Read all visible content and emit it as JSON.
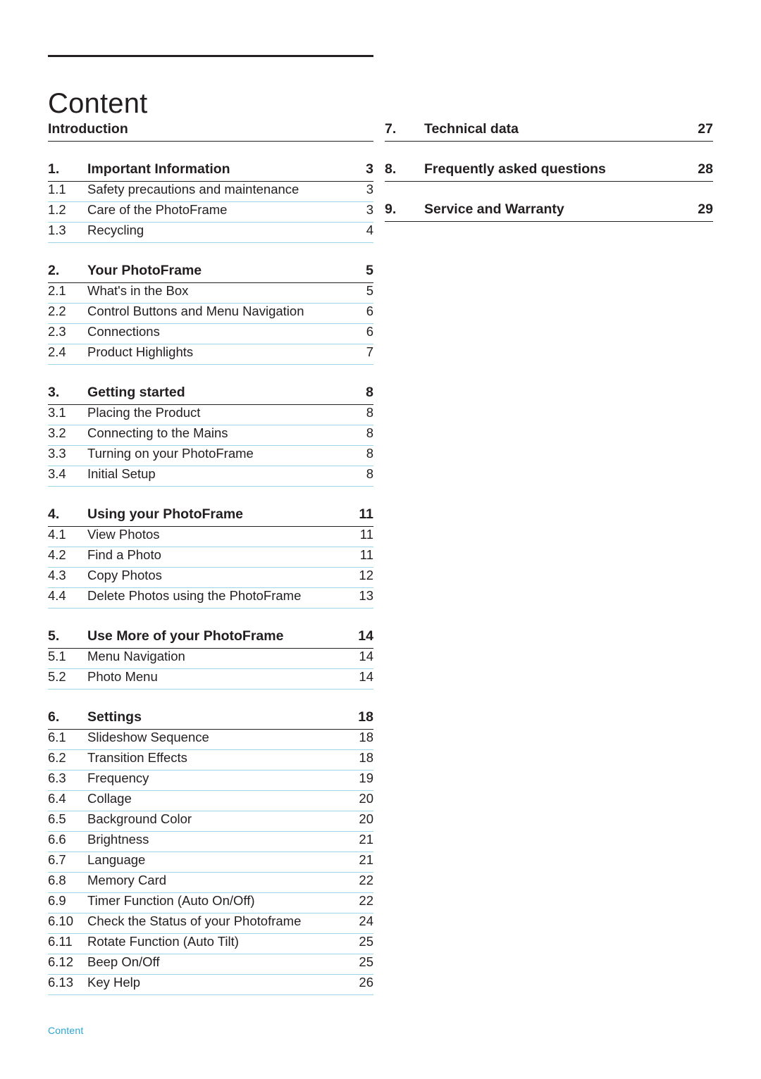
{
  "document": {
    "title": "Content",
    "footer": "Content",
    "accent_color": "#2ba6d9",
    "rule_color": "#9fd4e8",
    "text_color": "#231f20"
  },
  "left_column": [
    {
      "heading": {
        "num": "",
        "label": "Introduction",
        "page": ""
      },
      "entries": []
    },
    {
      "heading": {
        "num": "1.",
        "label": "Important Information",
        "page": "3"
      },
      "entries": [
        {
          "num": "1.1",
          "label": "Safety precautions and maintenance",
          "page": "3"
        },
        {
          "num": "1.2",
          "label": "Care of the PhotoFrame",
          "page": "3"
        },
        {
          "num": "1.3",
          "label": "Recycling",
          "page": "4"
        }
      ]
    },
    {
      "heading": {
        "num": "2.",
        "label": "Your PhotoFrame",
        "page": "5"
      },
      "entries": [
        {
          "num": "2.1",
          "label": "What's in the Box",
          "page": "5"
        },
        {
          "num": "2.2",
          "label": "Control Buttons and Menu Navigation",
          "page": "6"
        },
        {
          "num": "2.3",
          "label": "Connections",
          "page": "6"
        },
        {
          "num": "2.4",
          "label": "Product Highlights",
          "page": "7"
        }
      ]
    },
    {
      "heading": {
        "num": "3.",
        "label": "Getting started",
        "page": "8"
      },
      "entries": [
        {
          "num": "3.1",
          "label": "Placing the Product",
          "page": "8"
        },
        {
          "num": "3.2",
          "label": "Connecting to the Mains",
          "page": "8"
        },
        {
          "num": "3.3",
          "label": "Turning on your PhotoFrame",
          "page": "8"
        },
        {
          "num": "3.4",
          "label": "Initial Setup",
          "page": "8"
        }
      ]
    },
    {
      "heading": {
        "num": "4.",
        "label": "Using your PhotoFrame",
        "page": "11"
      },
      "entries": [
        {
          "num": "4.1",
          "label": "View Photos",
          "page": "11"
        },
        {
          "num": "4.2",
          "label": "Find a Photo",
          "page": "11"
        },
        {
          "num": "4.3",
          "label": "Copy Photos",
          "page": "12"
        },
        {
          "num": "4.4",
          "label": "Delete Photos using the PhotoFrame",
          "page": "13"
        }
      ]
    },
    {
      "heading": {
        "num": "5.",
        "label": "Use More of your PhotoFrame",
        "page": "14"
      },
      "entries": [
        {
          "num": "5.1",
          "label": "Menu Navigation",
          "page": "14"
        },
        {
          "num": "5.2",
          "label": "Photo Menu",
          "page": "14"
        }
      ]
    },
    {
      "heading": {
        "num": "6.",
        "label": "Settings",
        "page": "18"
      },
      "entries": [
        {
          "num": "6.1",
          "label": "Slideshow Sequence",
          "page": "18"
        },
        {
          "num": "6.2",
          "label": "Transition Effects",
          "page": "18"
        },
        {
          "num": "6.3",
          "label": "Frequency",
          "page": "19"
        },
        {
          "num": "6.4",
          "label": "Collage",
          "page": "20"
        },
        {
          "num": "6.5",
          "label": "Background Color",
          "page": "20"
        },
        {
          "num": "6.6",
          "label": "Brightness",
          "page": "21"
        },
        {
          "num": "6.7",
          "label": "Language",
          "page": "21"
        },
        {
          "num": "6.8",
          "label": "Memory Card",
          "page": "22"
        },
        {
          "num": "6.9",
          "label": "Timer Function (Auto On/Off)",
          "page": "22"
        },
        {
          "num": "6.10",
          "label": "Check the Status of your Photoframe",
          "page": "24"
        },
        {
          "num": "6.11",
          "label": "Rotate Function (Auto Tilt)",
          "page": "25"
        },
        {
          "num": "6.12",
          "label": "Beep On/Off",
          "page": "25"
        },
        {
          "num": "6.13",
          "label": "Key Help",
          "page": "26"
        }
      ]
    }
  ],
  "right_column": [
    {
      "heading": {
        "num": "7.",
        "label": "Technical data",
        "page": "27"
      },
      "entries": []
    },
    {
      "heading": {
        "num": "8.",
        "label": "Frequently asked questions",
        "page": "28"
      },
      "entries": []
    },
    {
      "heading": {
        "num": "9.",
        "label": "Service and Warranty",
        "page": "29"
      },
      "entries": []
    }
  ]
}
